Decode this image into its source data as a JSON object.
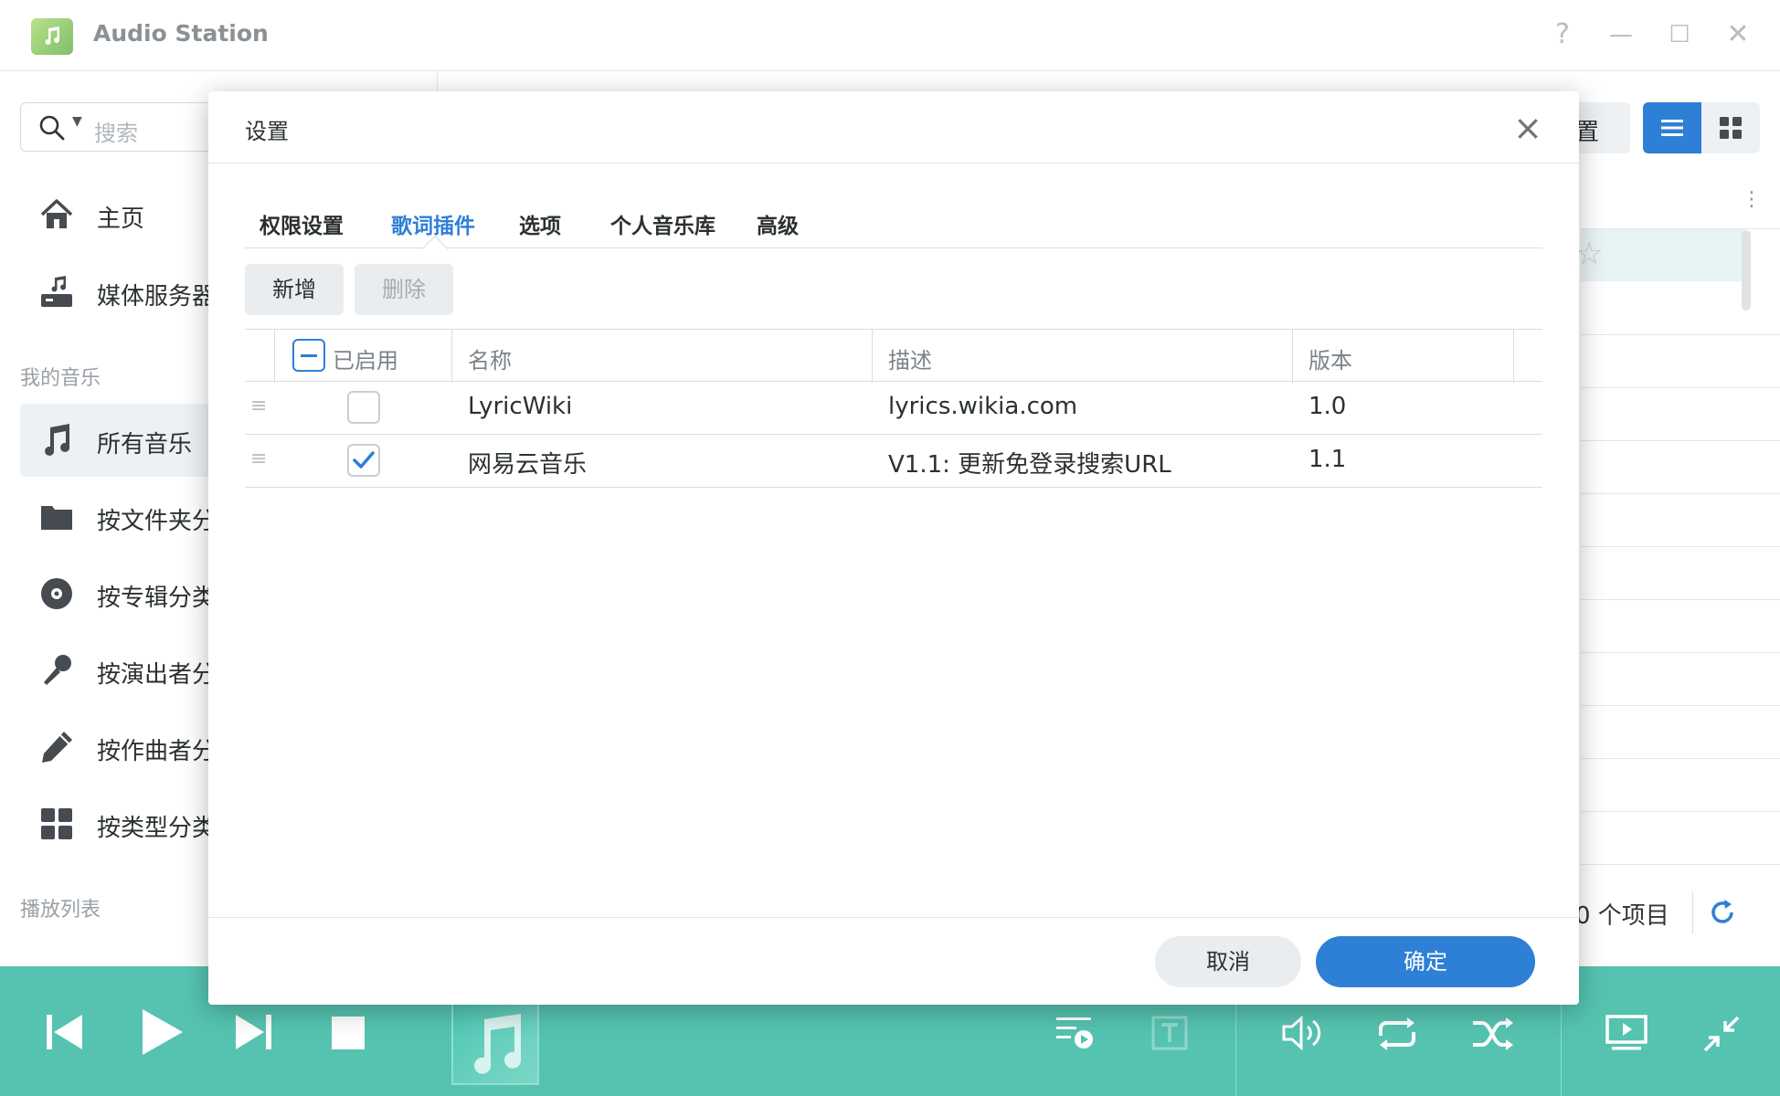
{
  "window": {
    "title": "Audio Station",
    "help": "?",
    "minimize": "—",
    "maximize": "☐",
    "close": "✕"
  },
  "sidebar": {
    "search_placeholder": "搜索",
    "items": [
      {
        "label": "主页"
      },
      {
        "label": "媒体服务器"
      }
    ],
    "section_my_music": "我的音乐",
    "my_music": [
      {
        "label": "所有音乐"
      },
      {
        "label": "按文件夹分类"
      },
      {
        "label": "按专辑分类"
      },
      {
        "label": "按演出者分类"
      },
      {
        "label": "按作曲者分类"
      },
      {
        "label": "按类型分类"
      }
    ],
    "section_playlist": "播放列表"
  },
  "background": {
    "settings_label_partial": "置",
    "count_label": "0 个项目"
  },
  "dialog": {
    "title": "设置",
    "tabs": [
      {
        "label": "权限设置"
      },
      {
        "label": "歌词插件"
      },
      {
        "label": "选项"
      },
      {
        "label": "个人音乐库"
      },
      {
        "label": "高级"
      }
    ],
    "active_tab": "歌词插件",
    "toolbar": {
      "add": "新增",
      "delete": "删除"
    },
    "columns": {
      "enabled": "已启用",
      "name": "名称",
      "description": "描述",
      "version": "版本"
    },
    "rows": [
      {
        "enabled": false,
        "name": "LyricWiki",
        "description": "lyrics.wikia.com",
        "version": "1.0"
      },
      {
        "enabled": true,
        "name": "网易云音乐",
        "description": "V1.1: 更新免登录搜索URL",
        "version": "1.1"
      }
    ],
    "cancel": "取消",
    "ok": "确定"
  },
  "colors": {
    "accent": "#2e7fd6",
    "player": "#55c3b0"
  }
}
